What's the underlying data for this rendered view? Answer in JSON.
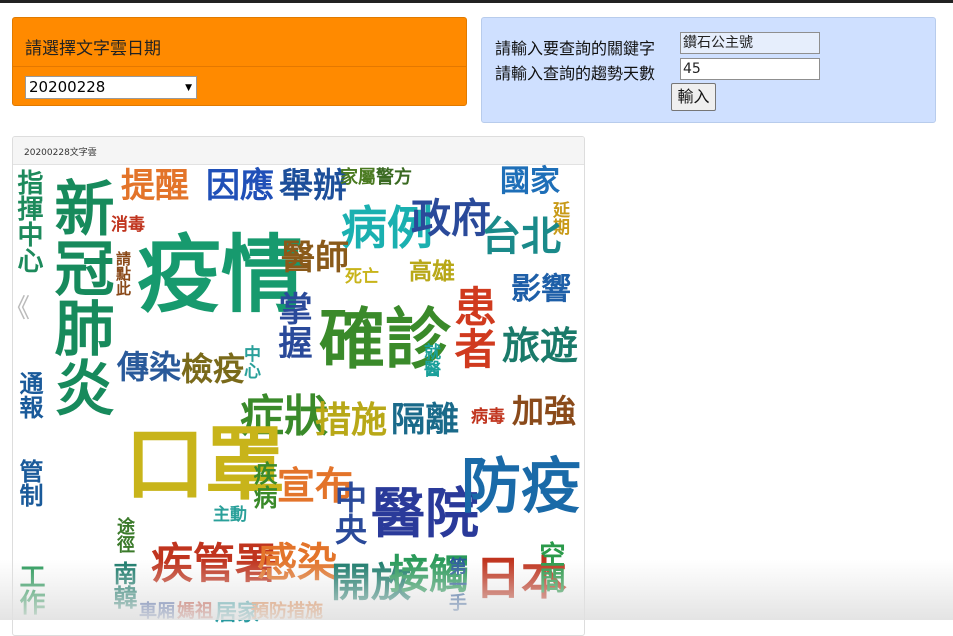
{
  "date_panel": {
    "title": "請選擇文字雲日期",
    "selected_date": "20200228"
  },
  "search_panel": {
    "keyword_label": "請輸入要查詢的關鍵字",
    "keyword_value": "鑽石公主號",
    "days_label": "請輸入查詢的趨勢天數",
    "days_value": "45",
    "submit_label": "輸入"
  },
  "cloud": {
    "header": "20200228文字雲",
    "prev_glyph": "《",
    "words": [
      {
        "text": "新冠肺炎",
        "color": "#178a5c"
      },
      {
        "text": "疫情",
        "color": "#179a6e"
      },
      {
        "text": "指揮中心",
        "color": "#1d8a5c"
      },
      {
        "text": "提醒",
        "color": "#e3742a"
      },
      {
        "text": "因應",
        "color": "#2050b8"
      },
      {
        "text": "舉辦",
        "color": "#1d4f9a"
      },
      {
        "text": "家屬",
        "color": "#4a7a20"
      },
      {
        "text": "警方",
        "color": "#3a6a22"
      },
      {
        "text": "國家",
        "color": "#1e6fb8"
      },
      {
        "text": "延期",
        "color": "#c89a18"
      },
      {
        "text": "消毒",
        "color": "#c0341e"
      },
      {
        "text": "病例",
        "color": "#1ab0b0"
      },
      {
        "text": "政府",
        "color": "#2a4a9a"
      },
      {
        "text": "台北",
        "color": "#1a8a8a"
      },
      {
        "text": "醫師",
        "color": "#8a5a1a"
      },
      {
        "text": "死亡",
        "color": "#c8b41a"
      },
      {
        "text": "高雄",
        "color": "#b8a818"
      },
      {
        "text": "影響",
        "color": "#1e5fa8"
      },
      {
        "text": "請點此",
        "color": "#8a4a1a"
      },
      {
        "text": "掌握",
        "color": "#2a4a9a"
      },
      {
        "text": "確診",
        "color": "#3a8a2a"
      },
      {
        "text": "患者",
        "color": "#d03a1e"
      },
      {
        "text": "旅遊",
        "color": "#1a7a6a"
      },
      {
        "text": "就醫",
        "color": "#1aa09a"
      },
      {
        "text": "傳染",
        "color": "#2a5a9a"
      },
      {
        "text": "檢疫",
        "color": "#7a6a1a"
      },
      {
        "text": "中心",
        "color": "#2aa09a"
      },
      {
        "text": "通報",
        "color": "#1a5a9a"
      },
      {
        "text": "症狀",
        "color": "#3a8a2a"
      },
      {
        "text": "措施",
        "color": "#b8a818"
      },
      {
        "text": "隔離",
        "color": "#1a6a8a"
      },
      {
        "text": "加強",
        "color": "#8a4a1a"
      },
      {
        "text": "病毒",
        "color": "#c0341e"
      },
      {
        "text": "口罩",
        "color": "#c8b41a"
      },
      {
        "text": "管制",
        "color": "#1a5a9a"
      },
      {
        "text": "疾病",
        "color": "#3a8a2a"
      },
      {
        "text": "宣布",
        "color": "#e3742a"
      },
      {
        "text": "中央",
        "color": "#2a4a9a"
      },
      {
        "text": "醫院",
        "color": "#2a3a9a"
      },
      {
        "text": "防疫",
        "color": "#1a6aa8"
      },
      {
        "text": "主動",
        "color": "#2aa09a"
      },
      {
        "text": "途徑",
        "color": "#3a7a2a"
      },
      {
        "text": "疾管署",
        "color": "#c0341e"
      },
      {
        "text": "感染",
        "color": "#e3742a"
      },
      {
        "text": "開放",
        "color": "#1a7a6a"
      },
      {
        "text": "接觸",
        "color": "#2a9a5a"
      },
      {
        "text": "第一手",
        "color": "#2a5a9a"
      },
      {
        "text": "日本",
        "color": "#c0341e"
      },
      {
        "text": "空間",
        "color": "#2a9a4a"
      },
      {
        "text": "工作",
        "color": "#2a9a5a"
      },
      {
        "text": "南韓",
        "color": "#1a7a6a"
      },
      {
        "text": "車厢",
        "color": "#2a4a9a"
      },
      {
        "text": "媽祖",
        "color": "#c0341e"
      },
      {
        "text": "居家",
        "color": "#2a9aa0"
      },
      {
        "text": "預防措施",
        "color": "#e3742a"
      }
    ]
  }
}
